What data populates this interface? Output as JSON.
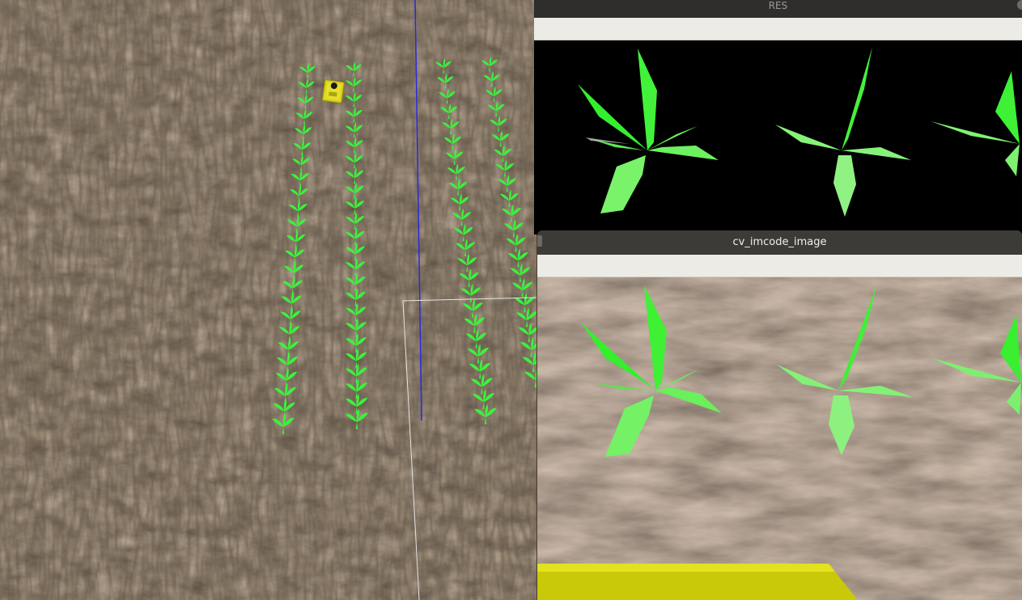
{
  "windows": {
    "res": {
      "title": "RES"
    },
    "cv": {
      "title": "cv_imcode_image"
    }
  },
  "scene": {
    "ground_color": "#4e3f31",
    "plant_color": "#3cf23c",
    "robot_color": "#d9d21a",
    "axis_color": "#2a2ae0",
    "grid_color": "#e6e6e6"
  },
  "icons": {
    "res_close": "close-icon",
    "cv_side": "window-control-icon"
  }
}
